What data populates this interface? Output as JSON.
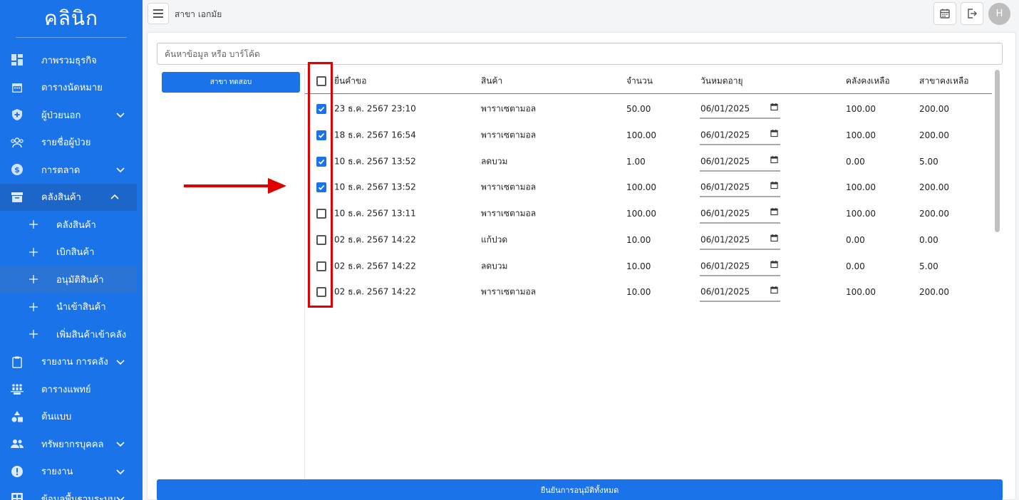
{
  "app": {
    "brand": "คลินิก"
  },
  "sidebar": {
    "items": [
      {
        "label": "ภาพรวมธุรกิจ",
        "icon": "dashboard-icon",
        "chevron": null
      },
      {
        "label": "ตารางนัดหมาย",
        "icon": "calendar-icon",
        "chevron": null
      },
      {
        "label": "ผู้ป่วยนอก",
        "icon": "shield-icon",
        "chevron": "down"
      },
      {
        "label": "รายชื่อผู้ป่วย",
        "icon": "people-icon",
        "chevron": null
      },
      {
        "label": "การตลาด",
        "icon": "dollar-icon",
        "chevron": "down"
      },
      {
        "label": "คลังสินค้า",
        "icon": "archive-icon",
        "chevron": "up",
        "active": true
      },
      {
        "label": "คลังสินค้า",
        "icon": "plus-icon",
        "sub": true
      },
      {
        "label": "เบิกสินค้า",
        "icon": "plus-icon",
        "sub": true
      },
      {
        "label": "อนุมัติสินค้า",
        "icon": "plus-icon",
        "sub": true,
        "active": true
      },
      {
        "label": "นำเข้าสินค้า",
        "icon": "plus-icon",
        "sub": true
      },
      {
        "label": "เพิ่มสินค้าเข้าคลัง",
        "icon": "plus-icon",
        "sub": true
      },
      {
        "label": "รายงาน การคลัง",
        "icon": "clipboard-icon",
        "chevron": "down"
      },
      {
        "label": "ตารางแพทย์",
        "icon": "team-icon",
        "chevron": null
      },
      {
        "label": "ต้นแบบ",
        "icon": "shapes-icon",
        "chevron": null
      },
      {
        "label": "ทรัพยากรบุคคล",
        "icon": "group-icon",
        "chevron": "down"
      },
      {
        "label": "รายงาน",
        "icon": "alert-icon",
        "chevron": "down"
      },
      {
        "label": "ข้อมูลพื้นฐานระบบ",
        "icon": "grid-icon",
        "chevron": "down"
      }
    ]
  },
  "topbar": {
    "branch": "สาขา เอกมัย",
    "avatar_letter": "H"
  },
  "main": {
    "search_placeholder": "ค้นหาข้อมูล หรือ บาร์โค้ด",
    "branch_button": "สาขา ทดสอบ",
    "confirm_button": "ยืนยันการอนุมัติทั้งหมด",
    "columns": [
      "ยื่นคำขอ",
      "สินค้า",
      "จำนวน",
      "วันหมดอายุ",
      "คลังคงเหลือ",
      "สาขาคงเหลือ"
    ],
    "header_checked": false,
    "rows": [
      {
        "checked": true,
        "date": "23 ธ.ค. 2567 23:10",
        "product": "พาราเซตามอล",
        "qty": "50.00",
        "expiry": "06/01/2025",
        "warehouse": "100.00",
        "branch": "200.00"
      },
      {
        "checked": true,
        "date": "18 ธ.ค. 2567 16:54",
        "product": "พาราเซตามอล",
        "qty": "100.00",
        "expiry": "06/01/2025",
        "warehouse": "100.00",
        "branch": "200.00"
      },
      {
        "checked": true,
        "date": "10 ธ.ค. 2567 13:52",
        "product": "ลดบวม",
        "qty": "1.00",
        "expiry": "06/01/2025",
        "warehouse": "0.00",
        "branch": "5.00"
      },
      {
        "checked": true,
        "date": "10 ธ.ค. 2567 13:52",
        "product": "พาราเซตามอล",
        "qty": "100.00",
        "expiry": "06/01/2025",
        "warehouse": "100.00",
        "branch": "200.00"
      },
      {
        "checked": false,
        "date": "10 ธ.ค. 2567 13:11",
        "product": "พาราเซตามอล",
        "qty": "100.00",
        "expiry": "06/01/2025",
        "warehouse": "100.00",
        "branch": "200.00"
      },
      {
        "checked": false,
        "date": "02 ธ.ค. 2567 14:22",
        "product": "แก้ปวด",
        "qty": "10.00",
        "expiry": "06/01/2025",
        "warehouse": "0.00",
        "branch": "0.00"
      },
      {
        "checked": false,
        "date": "02 ธ.ค. 2567 14:22",
        "product": "ลดบวม",
        "qty": "10.00",
        "expiry": "06/01/2025",
        "warehouse": "0.00",
        "branch": "5.00"
      },
      {
        "checked": false,
        "date": "02 ธ.ค. 2567 14:22",
        "product": "พาราเซตามอล",
        "qty": "10.00",
        "expiry": "06/01/2025",
        "warehouse": "100.00",
        "branch": "200.00"
      }
    ]
  },
  "colors": {
    "primary": "#1a73e8",
    "annotation": "#e00000"
  }
}
